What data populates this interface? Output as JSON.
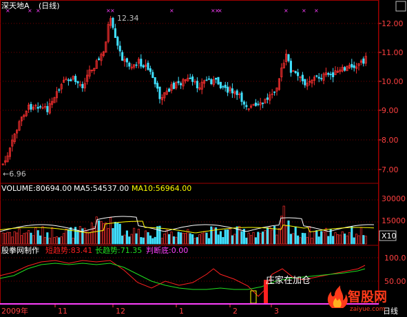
{
  "colors": {
    "background": "#000000",
    "frame": "#a00000",
    "up": "#ff3030",
    "down": "#40e0ff",
    "grid": "#7a0000",
    "axis_text": "#ff4040",
    "marker": "#ff40ff",
    "ma5": "#ffffff",
    "ma10": "#ffff00",
    "short_trend": "#ff2020",
    "long_trend": "#20e020",
    "judge": "#ff40ff",
    "white": "#ffffff"
  },
  "header": {
    "title": "深天地A",
    "period": "(日线)"
  },
  "price_panel": {
    "high_label": "12.34",
    "low_label": "←6.96",
    "y_ticks": [
      "12.00",
      "11.00",
      "10.00",
      "9.00",
      "8.00",
      "7.00"
    ]
  },
  "volume_panel": {
    "volume_label": "VOLUME:80694.00",
    "ma5_label": "MA5:54537.00",
    "ma10_label": "MA10:56964.00",
    "y_ticks": [
      "30000",
      "15000"
    ],
    "unit": "X10"
  },
  "indicator_panel": {
    "name": "股拳网制作",
    "short_label": "短趋势:83.41",
    "long_label": "长趋势:71.35",
    "judge_label": "判断底:0.00",
    "annotation": "庄家在加仓",
    "y_ticks": [
      "100.0",
      "50.00"
    ]
  },
  "x_axis": {
    "labels": [
      "2009年",
      "11",
      "12",
      "1",
      "2",
      "3"
    ],
    "right_label": "日线"
  },
  "watermark": {
    "text": "智股网",
    "url": "zaiyue.com"
  }
}
